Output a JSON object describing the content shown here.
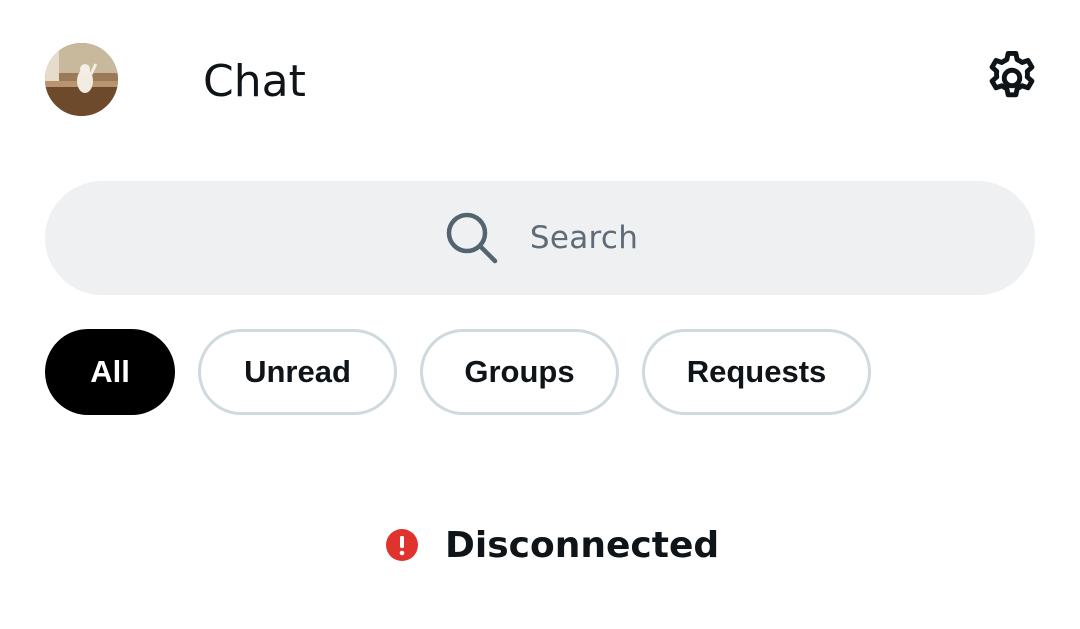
{
  "header": {
    "title": "Chat",
    "avatar_icon": "user-avatar-photo",
    "settings_icon": "gear-icon"
  },
  "search": {
    "icon": "search-icon",
    "placeholder": "Search"
  },
  "filters": {
    "active": "All",
    "tabs": [
      {
        "label": "All"
      },
      {
        "label": "Unread"
      },
      {
        "label": "Groups"
      },
      {
        "label": "Requests"
      }
    ]
  },
  "status": {
    "icon": "alert-icon",
    "text": "Disconnected",
    "color": "#e0332e"
  },
  "colors": {
    "active_tab_bg": "#000000",
    "search_bg": "#eff0f2",
    "tab_border": "#cfd9de",
    "text": "#0f1419"
  }
}
